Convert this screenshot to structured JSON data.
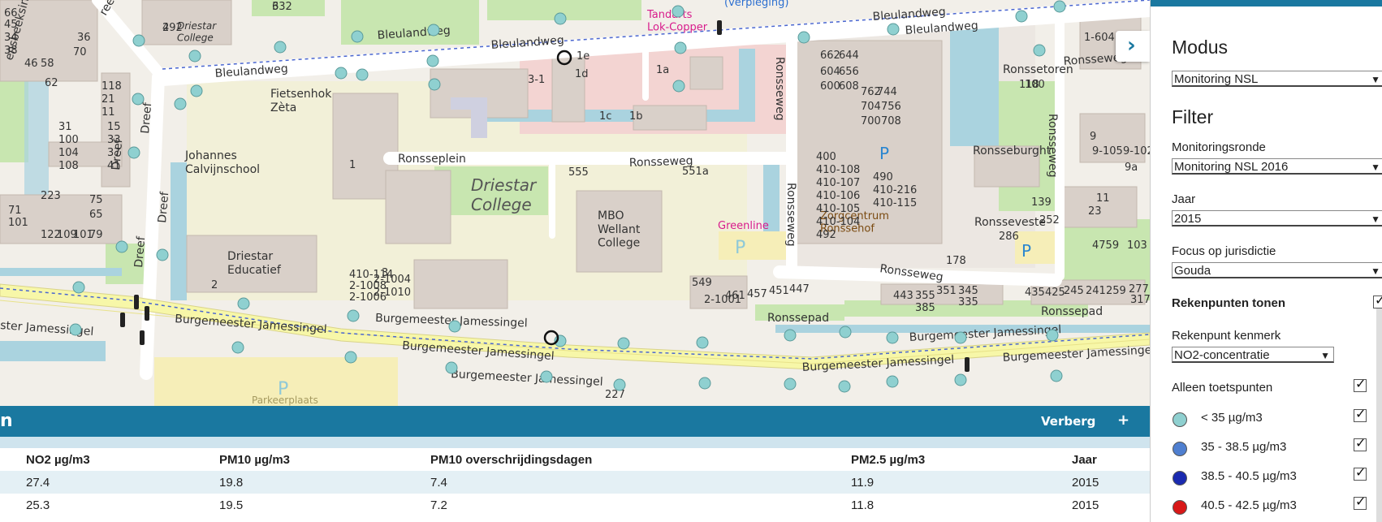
{
  "map": {
    "streets": {
      "bleulandweg_1": "Bleulandweg",
      "bleulandweg_2": "Bleulandweg",
      "bleulandweg_3": "Bleulandweg",
      "bleulandweg_4": "Bleulandweg",
      "bleulandweg_5": "Bleulandweg",
      "ronsseplein": "Ronsseplein",
      "ronsseweg_1": "Ronsseweg",
      "ronsseweg_2": "Ronsseweg",
      "ronsseweg_3": "Ronsseweg",
      "ronsseweg_4": "Ronsseweg",
      "ronsseweg_5": "Ronsseweg",
      "ronsseweg_6": "Ronsseweg",
      "dreef_1": "Dreef",
      "dreef_2": "Dreef",
      "dreef_3": "Dreef",
      "dreef_4": "Dreef",
      "jamessingel_1": "Burgemeester Jamessingel",
      "jamessingel_2": "Burgemeester Jamessingel",
      "jamessingel_3": "Burgemeester Jamessingel",
      "jamessingel_4": "Burgemeester Jamessingel",
      "jamessingel_5": "Burgemeester Jamessingel",
      "jamessingel_6": "Burgemeester Jamessingel",
      "jamessingel_7": "Burgemeester Jamessingel",
      "jamessingel_8": "ster Jamessingel",
      "ronssepad_1": "Ronssepad",
      "ronssepad_2": "Ronssepad",
      "ronssetoren": "Ronssetoren",
      "ronsseburght": "Ronsseburght",
      "ronsseveste": "Ronsseveste",
      "sbeeksingel": "ensbeeksingel",
      "reef": "reef"
    },
    "pois": {
      "driestar_college_small": "Driestar\nCollege",
      "driestar_college": "Driestar\nCollege",
      "fietsenhok": "Fietsenhok\nZèta",
      "calvijnschool": "Johannes\nCalvijnschool",
      "driestar_educatief": "Driestar\nEducatief",
      "mbo_wellant": "MBO\nWellant\nCollege",
      "greenline": "Greenline",
      "tandarts": "Tandarts\nLok-Copper",
      "verpleging": "(verpleging)",
      "zorgcentrum": "Zorgcentrum\nRonssehof",
      "parkeer": "Parkeerplaats",
      "p1": "P",
      "p2": "P",
      "p3": "P",
      "p4": "P"
    },
    "numbers": [
      "492",
      "332",
      "1e",
      "1d",
      "1a",
      "3-1",
      "1c",
      "1b",
      "555",
      "551a",
      "549",
      "3",
      "1",
      "2",
      "662",
      "644",
      "604",
      "656",
      "600",
      "608",
      "762",
      "744",
      "704",
      "756",
      "700",
      "708",
      "118",
      "100",
      "1-604",
      "9",
      "9-105",
      "9-102",
      "9a",
      "11",
      "23",
      "4759",
      "103",
      "139",
      "252",
      "286",
      "178",
      "400",
      "410-108",
      "410-107",
      "410-106",
      "410-105",
      "410-104",
      "492",
      "490",
      "410-216",
      "410-115",
      "410-114",
      "2-1008",
      "2-1006",
      "2-1004",
      "2-1010",
      "2-1001",
      "461",
      "457",
      "451",
      "447",
      "443",
      "355",
      "351",
      "345",
      "385",
      "335",
      "435",
      "425",
      "245",
      "241",
      "259",
      "277",
      "317",
      "227",
      "223",
      "101",
      "122",
      "109",
      "101",
      "79",
      "75",
      "65",
      "71",
      "31",
      "100",
      "104",
      "108",
      "118",
      "21",
      "11",
      "15",
      "33",
      "37",
      "41",
      "45",
      "34",
      "38",
      "46",
      "58",
      "62",
      "66",
      "70",
      "36",
      "2",
      "6"
    ]
  },
  "bottom_panel": {
    "title": "n",
    "hide_label": "Verberg",
    "expand_label": "+",
    "columns": [
      "NO2 µg/m3",
      "PM10 µg/m3",
      "PM10 overschrijdingsdagen",
      "PM2.5 µg/m3",
      "Jaar"
    ],
    "rows": [
      [
        "27.4",
        "19.8",
        "7.4",
        "11.9",
        "2015"
      ],
      [
        "25.3",
        "19.5",
        "7.2",
        "11.8",
        "2015"
      ]
    ]
  },
  "panel": {
    "modus_heading": "Modus",
    "modus_value": "Monitoring NSL",
    "filter_heading": "Filter",
    "ronde_label": "Monitoringsronde",
    "ronde_value": "Monitoring NSL 2016",
    "jaar_label": "Jaar",
    "jaar_value": "2015",
    "focus_label": "Focus op jurisdictie",
    "focus_value": "Gouda",
    "rekenpunten_label": "Rekenpunten tonen",
    "kenmerk_label": "Rekenpunt kenmerk",
    "kenmerk_value": "NO2-concentratie",
    "toetspunten_label": "Alleen toetspunten",
    "legend": [
      {
        "label": "< 35 µg/m3",
        "color": "#8fd0d0"
      },
      {
        "label": "35 - 38.5 µg/m3",
        "color": "#4f7fd0"
      },
      {
        "label": "38.5 - 40.5 µg/m3",
        "color": "#1a2ab0"
      },
      {
        "label": "40.5 - 42.5 µg/m3",
        "color": "#d81818"
      }
    ]
  },
  "colors": {
    "accent": "#1a78a0",
    "road_main": "#f7f7a8",
    "water": "#aad3df",
    "building": "#d9d0c9",
    "green": "#c8e6b0"
  }
}
